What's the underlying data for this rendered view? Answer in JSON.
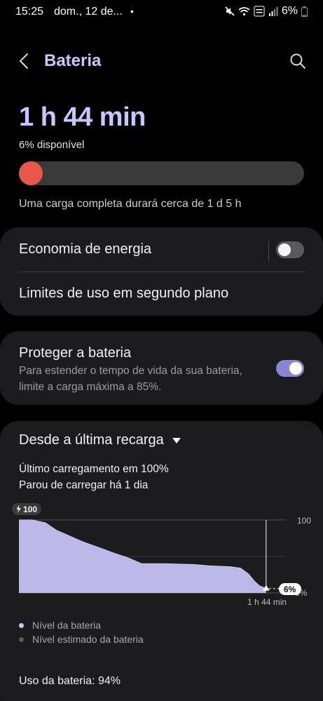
{
  "status_bar": {
    "time": "15:25",
    "date": "dom., 12 de...",
    "dot": "•",
    "battery_text": "6%"
  },
  "header": {
    "title": "Bateria",
    "back_icon": "chevron-left-icon",
    "search_icon": "search-icon"
  },
  "battery": {
    "time_left": "1 h 44 min",
    "available": "6% disponível",
    "level_fraction": 0.06,
    "full_charge_text": "Uma carga completa durará cerca de 1 d 5 h"
  },
  "settings": {
    "energy_saving": {
      "label": "Economia de energia",
      "enabled": false
    },
    "background_limits": {
      "label": "Limites de uso em segundo plano"
    },
    "protect_battery": {
      "label": "Proteger a bateria",
      "description": "Para estender o tempo de vida da sua bateria, limite a carga máxima a 85%.",
      "enabled": true
    }
  },
  "history": {
    "period_label": "Desde a última recarga",
    "last_charge": "Último carregamento em 100%",
    "stopped": "Parou de carregar há 1 dia",
    "usage": "Uso da bateria: 94%"
  },
  "colors": {
    "accent": "#c9c6ff",
    "level_fill": "#e8574a",
    "area_fill": "#bbb7e6",
    "toggle_on": "#8a84d6",
    "card_bg": "#1c1c1e"
  },
  "chart_data": {
    "type": "area",
    "y_max_label": "100",
    "y_min_label": "0%",
    "start_badge": "100",
    "current_badge": "6%",
    "now_label": "1 h 44 min",
    "ylim": [
      0,
      100
    ],
    "x": [
      0,
      5,
      10,
      14,
      19,
      24,
      30,
      36,
      41,
      46,
      55,
      65,
      72,
      79,
      83,
      86,
      88,
      90,
      92.6
    ],
    "values": [
      100,
      100,
      96,
      86,
      78,
      70,
      62,
      54,
      48,
      40,
      40,
      39,
      37,
      36,
      34,
      26,
      17,
      10,
      6
    ],
    "series": [
      {
        "name": "Nível da bateria",
        "color": "#bbb7e6"
      },
      {
        "name": "Nível estimado da bateria",
        "color": "#5a5a66"
      }
    ],
    "grid": true
  }
}
